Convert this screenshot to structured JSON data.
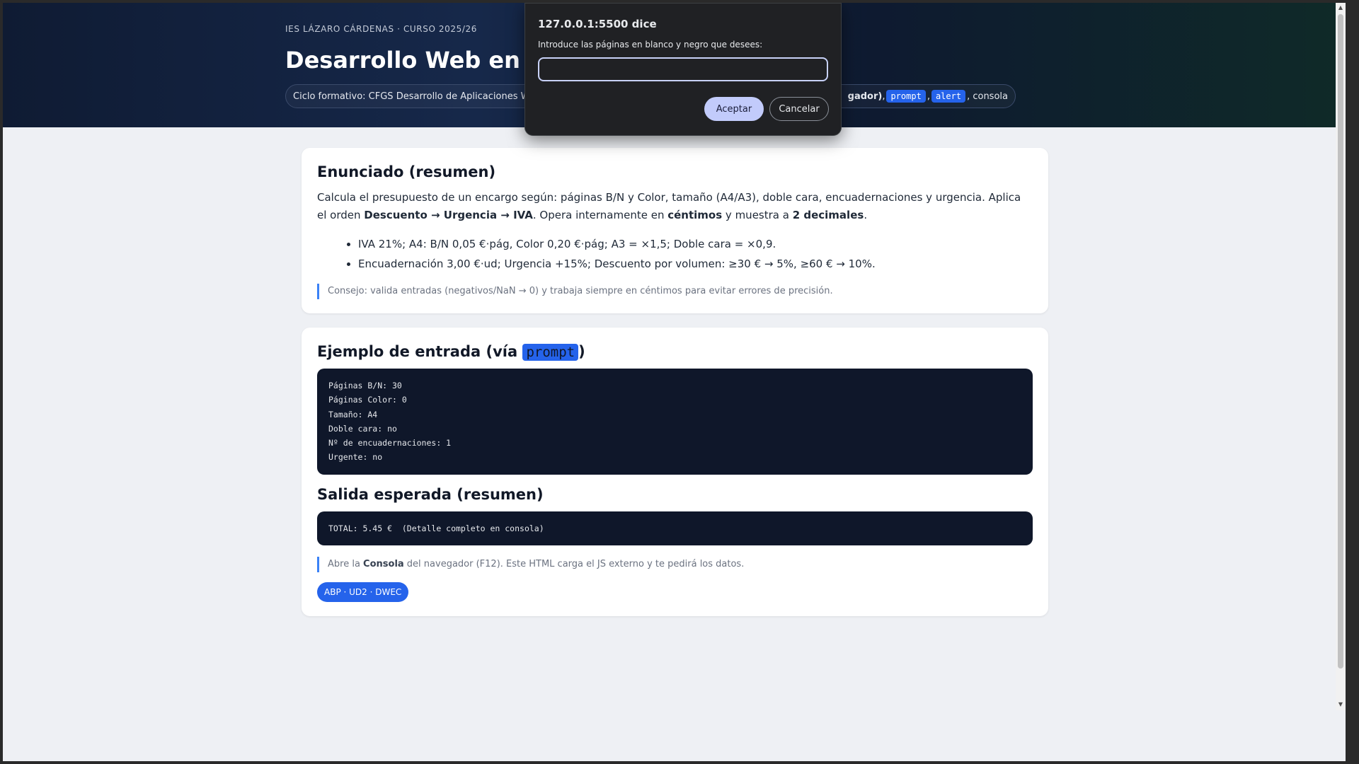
{
  "hero": {
    "eyebrow": "IES LÁZARO CÁRDENAS · CURSO 2025/26",
    "title": "Desarrollo Web en Ent",
    "pill": {
      "text_start": "Ciclo formativo: CFGS Desarrollo de Aplicaciones Web (I",
      "text_mid": "gador)",
      "sep1": " , ",
      "tag1": "prompt",
      "sep2": " , ",
      "tag2": "alert",
      "text_end": " , consola"
    }
  },
  "enunciado": {
    "title": "Enunciado (resumen)",
    "p1": "Calcula el presupuesto de un encargo según: páginas B/N y Color, tamaño (A4/A3), doble cara, encuadernaciones y urgencia. Aplica el orden",
    "order": "Descuento → Urgencia → IVA",
    "p2": ". Opera internamente en ",
    "cents": "céntimos",
    "p3": " y muestra a ",
    "decimals": "2 decimales",
    "p4": ".",
    "bullets": [
      "IVA 21%; A4: B/N 0,05 €·pág, Color 0,20 €·pág; A3 = ×1,5; Doble cara = ×0,9.",
      "Encuadernación 3,00 €·ud; Urgencia +15%; Descuento por volumen: ≥30 € → 5%, ≥60 € → 10%."
    ],
    "tip": "Consejo: valida entradas (negativos/NaN → 0) y trabaja siempre en céntimos para evitar errores de precisión."
  },
  "ejemplo": {
    "title_start": "Ejemplo de entrada (vía ",
    "title_code": "prompt",
    "title_end": ")",
    "input_code": "Páginas B/N: 30\nPáginas Color: 0\nTamaño: A4\nDoble cara: no\nNº de encuadernaciones: 1\nUrgente: no",
    "output_title": "Salida esperada (resumen)",
    "output_code": "TOTAL: 5.45 €  (Detalle completo en consola)",
    "note_start": "Abre la ",
    "note_bold": "Consola",
    "note_end": " del navegador (F12). Este HTML carga el JS externo y te pedirá los datos.",
    "badge": "ABP · UD2 · DWEC"
  },
  "dialog": {
    "origin": "127.0.0.1:5500 dice",
    "message": "Introduce las páginas en blanco y negro que desees:",
    "input_value": "",
    "ok_label": "Aceptar",
    "cancel_label": "Cancelar"
  },
  "icons": {
    "scroll_up": "▲",
    "scroll_down": "▼"
  },
  "colors": {
    "accent": "#2563eb",
    "code_bg": "#0f172a",
    "hero_bg": "#0f1b33"
  }
}
